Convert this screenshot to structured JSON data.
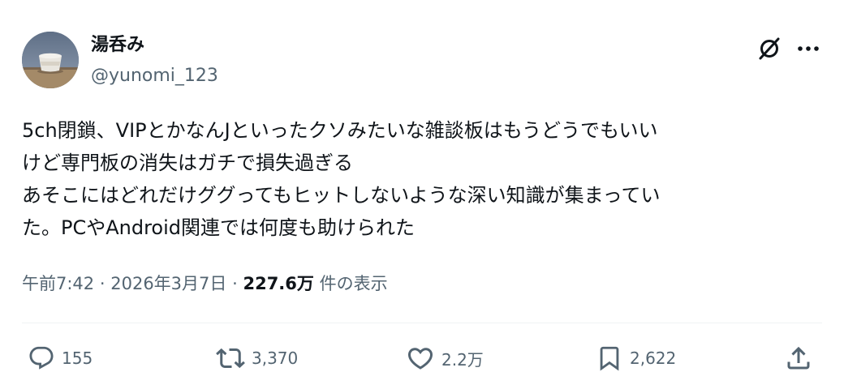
{
  "author": {
    "display_name": "湯呑み",
    "handle": "@yunomi_123",
    "avatar_icon": "teacup-photo-avatar"
  },
  "post": {
    "lines": [
      "5ch閉鎖、VIPとかなんJといったクソみたいな雑談板はもうどうでもいい",
      "けど専門板の消失はガチで損失過ぎる",
      "あそこにはどれだけググってもヒットしないような深い知識が集まってい",
      "た。PCやAndroid関連では何度も助けられた"
    ]
  },
  "meta": {
    "time": "午前7:42",
    "separator": "·",
    "date": "2026年3月7日",
    "views_count": "227.6万",
    "views_label": "件の表示"
  },
  "actions": {
    "reply_count": "155",
    "repost_count": "3,370",
    "like_count": "2.2万",
    "bookmark_count": "2,622"
  },
  "colors": {
    "text": "#0f1419",
    "secondary": "#536471",
    "divider": "#eff3f4"
  }
}
